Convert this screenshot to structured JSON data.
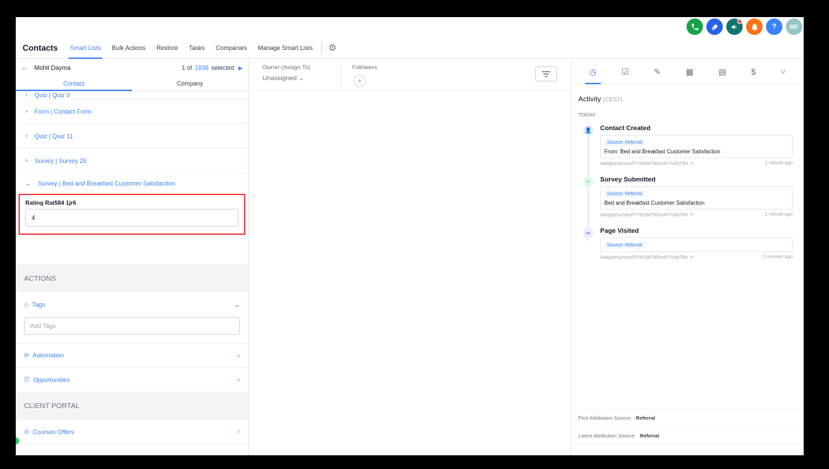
{
  "colors": {
    "accent": "#3b82f6",
    "highlight": "#ef4444"
  },
  "top_icons": [
    {
      "icon": "phone-icon",
      "color": "#16a34a"
    },
    {
      "icon": "rocket-icon",
      "color": "#2563eb"
    },
    {
      "icon": "megaphone-icon",
      "color": "#0f766e"
    },
    {
      "icon": "bell-icon",
      "color": "#f97316"
    },
    {
      "icon": "help-icon",
      "color": "#3b82f6",
      "text": "?"
    },
    {
      "icon": "avatar-icon",
      "color": "#93c5c5",
      "text": "MD"
    }
  ],
  "nav": {
    "title": "Contacts",
    "tabs": [
      "Smart Lists",
      "Bulk Actions",
      "Restore",
      "Tasks",
      "Companies",
      "Manage Smart Lists"
    ]
  },
  "contact": {
    "name": "Mohit Dayma",
    "pager_prefix": "1 of",
    "pager_total": "1838",
    "pager_suffix": "selected"
  },
  "subtabs": [
    "Contact",
    "Company"
  ],
  "accordions": [
    "Quiz | Quiz 0",
    "Form | Contact Form",
    "Quiz | Quiz 11",
    "Survey | Survey 25",
    "Survey | Bed and Breakfast Customer Satisfaction"
  ],
  "rating": {
    "label": "Rating Rat584 1jr6",
    "value": "4"
  },
  "actions": {
    "heading": "ACTIONS",
    "tags_label": "Tags",
    "tags_placeholder": "Add Tags",
    "automation_label": "Automation",
    "opportunities_label": "Opportunities"
  },
  "client_portal": {
    "heading": "CLIENT PORTAL",
    "courses_label": "Courses Offers"
  },
  "middle": {
    "owner_label": "Owner (Assign To)",
    "owner_value": "Unassigned",
    "followers_label": "Followers"
  },
  "activity": {
    "title": "Activity",
    "tz": "(CEST)",
    "today": "TODAY",
    "events": [
      {
        "title": "Contact Created",
        "badge": "Source: Referral",
        "text": "From: Bed and Breakfast Customer Satisfaction",
        "url": "/widget/survey/lYYt5SwTdDm4VYufqT9H",
        "time": "1 minute ago"
      },
      {
        "title": "Survey Submitted",
        "badge": "Source: Referral",
        "text": "Bed and Breakfast Customer Satisfaction",
        "url": "/widget/survey/lYYt5SwTdDm4VYufqT9H",
        "time": "1 minute ago"
      },
      {
        "title": "Page Visited",
        "badge": "Source: Referral",
        "url": "/widget/survey/lYYt5SwTdDm4VYufqT9H",
        "time": "2 minutes ago"
      }
    ]
  },
  "attribution": {
    "first_label": "First Attribution Source:",
    "first_value": "Referral",
    "latest_label": "Latest Attribution Source:",
    "latest_value": "Referral"
  }
}
